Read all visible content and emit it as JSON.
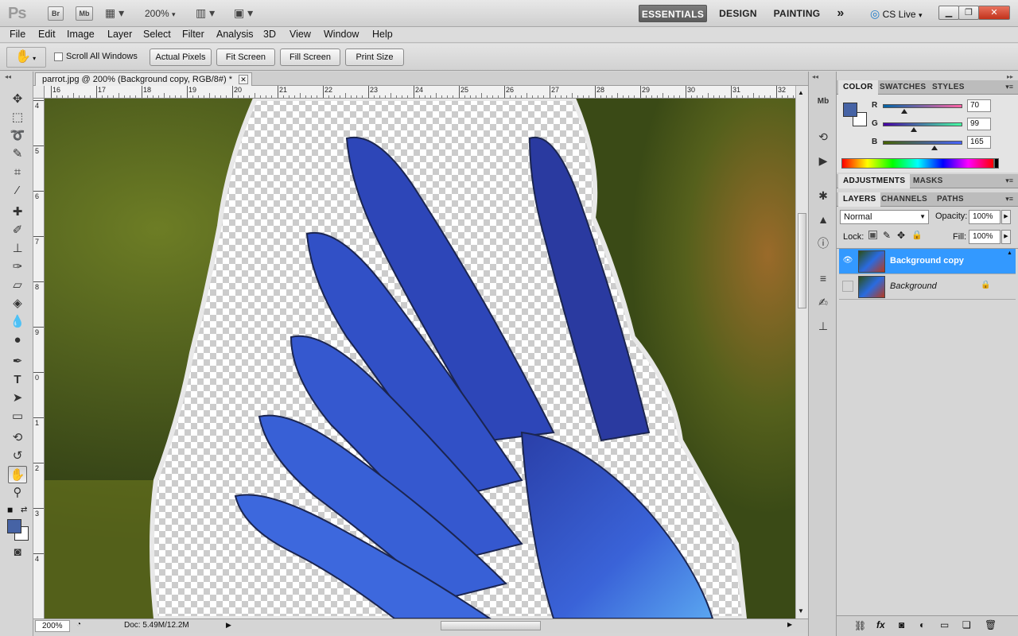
{
  "app": {
    "name": "Ps",
    "zoom_label": "200%"
  },
  "appbar": {
    "bridge": "Br",
    "mini_bridge": "Mb",
    "zoom": "200%",
    "workspaces": [
      "ESSENTIALS",
      "DESIGN",
      "PAINTING"
    ],
    "more": "»",
    "cs_live": "CS Live"
  },
  "menu": [
    "File",
    "Edit",
    "Image",
    "Layer",
    "Select",
    "Filter",
    "Analysis",
    "3D",
    "View",
    "Window",
    "Help"
  ],
  "options": {
    "scroll_all": "Scroll All Windows",
    "buttons": [
      "Actual Pixels",
      "Fit Screen",
      "Fill Screen",
      "Print Size"
    ]
  },
  "document": {
    "tab_title": "parrot.jpg @ 200% (Background copy, RGB/8#) *",
    "ruler_h": [
      "16",
      "17",
      "18",
      "19",
      "20",
      "21",
      "22",
      "23",
      "24",
      "25",
      "26",
      "27",
      "28",
      "29",
      "30",
      "31",
      "32"
    ],
    "ruler_v": [
      "4",
      "5",
      "6",
      "7",
      "8",
      "9",
      "0",
      "1",
      "2",
      "3",
      "4"
    ],
    "status_zoom": "200%",
    "status_doc": "Doc: 5.49M/12.2M"
  },
  "color_panel": {
    "tabs": [
      "COLOR",
      "SWATCHES",
      "STYLES"
    ],
    "r_label": "R",
    "g_label": "G",
    "b_label": "B",
    "r": "70",
    "g": "99",
    "b": "165",
    "r_frac": 0.27,
    "g_frac": 0.39,
    "b_frac": 0.65,
    "fg": "#4663a5"
  },
  "adjust_panel": {
    "tabs": [
      "ADJUSTMENTS",
      "MASKS"
    ]
  },
  "layers_panel": {
    "tabs": [
      "LAYERS",
      "CHANNELS",
      "PATHS"
    ],
    "blend": "Normal",
    "opacity_label": "Opacity:",
    "opacity": "100%",
    "lock_label": "Lock:",
    "fill_label": "Fill:",
    "fill": "100%",
    "layers": [
      {
        "name": "Background copy",
        "selected": true
      },
      {
        "name": "Background",
        "selected": false
      }
    ]
  },
  "colors": {
    "selection": "#3399ff",
    "accent_fg": "#4663a5"
  }
}
